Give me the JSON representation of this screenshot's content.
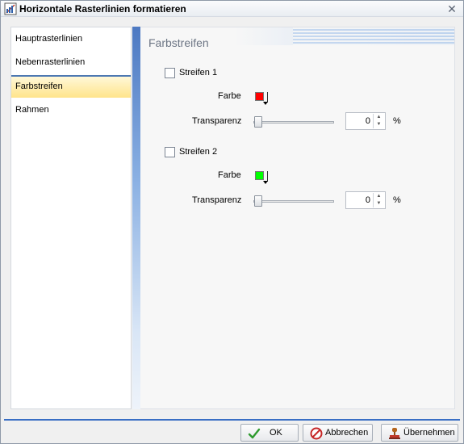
{
  "window": {
    "title": "Horizontale Rasterlinien formatieren"
  },
  "nav": {
    "items": [
      {
        "label": "Hauptrasterlinien"
      },
      {
        "label": "Nebenrasterlinien"
      },
      {
        "label": "Farbstreifen",
        "selected": true
      },
      {
        "label": "Rahmen"
      }
    ]
  },
  "content": {
    "section_title": "Farbstreifen",
    "stripe1": {
      "checkbox_label": "Streifen 1",
      "checked": false,
      "color_label": "Farbe",
      "color": "#ff0000",
      "transparency_label": "Transparenz",
      "transparency_value": "0",
      "unit": "%"
    },
    "stripe2": {
      "checkbox_label": "Streifen 2",
      "checked": false,
      "color_label": "Farbe",
      "color": "#00ff00",
      "transparency_label": "Transparenz",
      "transparency_value": "0",
      "unit": "%"
    }
  },
  "buttons": {
    "ok": "OK",
    "cancel": "Abbrechen",
    "apply": "Übernehmen"
  },
  "colors": {
    "accent": "#3a6fc4",
    "selected_item_bg": "#ffe48a"
  }
}
